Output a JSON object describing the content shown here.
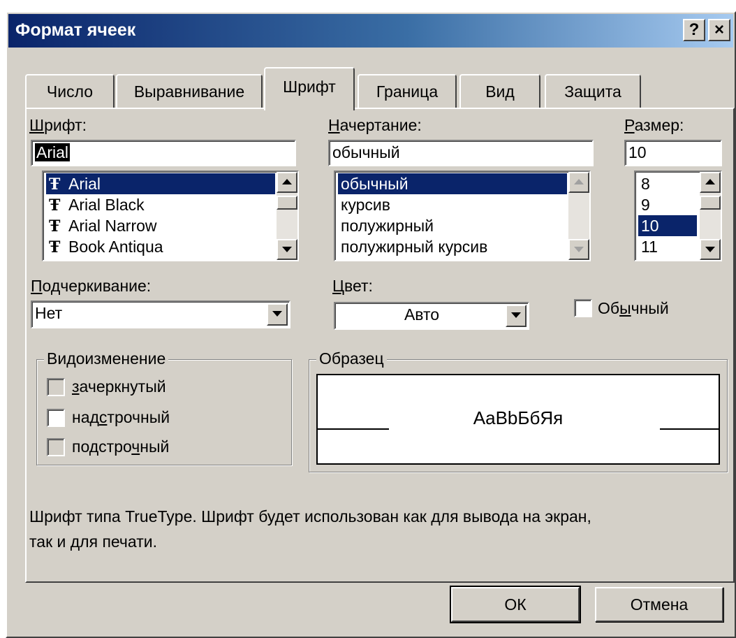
{
  "window": {
    "title": "Формат ячеек",
    "help_label": "?",
    "close_label": "×"
  },
  "tabs": [
    {
      "label": "Число"
    },
    {
      "label": "Выравнивание"
    },
    {
      "label": "Шрифт"
    },
    {
      "label": "Граница"
    },
    {
      "label": "Вид"
    },
    {
      "label": "Защита"
    }
  ],
  "active_tab": "Шрифт",
  "font": {
    "label_hotkey": "Ш",
    "label_rest": "рифт:",
    "value": "Arial",
    "items": [
      "Arial",
      "Arial Black",
      "Arial Narrow",
      "Book Antiqua"
    ],
    "selected": "Arial",
    "item_icon": "truetype-icon",
    "item_glyph": "Ŧ"
  },
  "style": {
    "label_hotkey": "Н",
    "label_rest": "ачертание:",
    "value": "обычный",
    "items": [
      "обычный",
      "курсив",
      "полужирный",
      "полужирный курсив"
    ],
    "selected": "обычный"
  },
  "size": {
    "label_hotkey": "Р",
    "label_rest": "азмер:",
    "value": "10",
    "items": [
      "8",
      "9",
      "10",
      "11"
    ],
    "selected": "10"
  },
  "underline": {
    "label_hotkey": "П",
    "label_rest": "одчеркивание:",
    "value": "Нет"
  },
  "color": {
    "label_hotkey": "Ц",
    "label_rest": "вет:",
    "value": "Авто"
  },
  "normal": {
    "label_pre": "Об",
    "label_hotkey": "ы",
    "label_rest": "чный",
    "checked": false
  },
  "effects": {
    "title": "Видоизменение",
    "strike": {
      "label_hotkey": "з",
      "label_rest": "ачеркнутый",
      "checked": false
    },
    "superscript": {
      "label_pre": "над",
      "label_hotkey": "с",
      "label_rest": "трочный",
      "checked": false
    },
    "subscript": {
      "label_pre": "подстро",
      "label_hotkey": "ч",
      "label_rest": "ный",
      "checked": false
    }
  },
  "preview": {
    "title": "Образец",
    "sample": "AaBbБбЯя"
  },
  "info_text_line1": "Шрифт типа TrueType. Шрифт будет использован как для вывода на экран,",
  "info_text_line2": "так и для печати.",
  "buttons": {
    "ok": "ОК",
    "cancel": "Отмена"
  },
  "icons": {
    "up": "scroll-up-arrow-icon",
    "down": "scroll-down-arrow-icon",
    "dropdown": "dropdown-arrow-icon"
  }
}
